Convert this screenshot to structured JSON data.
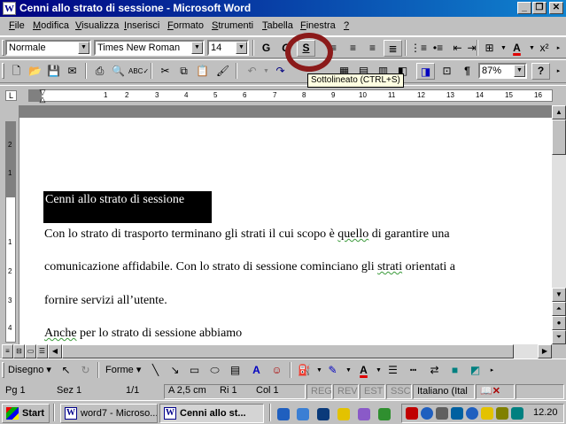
{
  "window": {
    "title": "Cenni allo strato di sessione - Microsoft Word",
    "buttons": {
      "minimize": "_",
      "restore": "❐",
      "close": "✕"
    }
  },
  "menu": [
    "File",
    "Modifica",
    "Visualizza",
    "Inserisci",
    "Formato",
    "Strumenti",
    "Tabella",
    "Finestra",
    "?"
  ],
  "formatting_toolbar": {
    "style": "Normale",
    "font": "Times New Roman",
    "size": "14",
    "bold": "G",
    "italic": "C",
    "underline": "S",
    "color_letter": "A"
  },
  "standard_toolbar": {
    "zoom": "87%",
    "pilcrow": "¶",
    "help": "?"
  },
  "tooltip": "Sottolineato (CTRL+S)",
  "ruler": {
    "numbers": [
      "1",
      "2",
      "3",
      "4",
      "5",
      "6",
      "7",
      "8",
      "9",
      "10",
      "11",
      "12",
      "13",
      "14",
      "15",
      "16"
    ],
    "vertical_numbers": [
      "2",
      "1",
      "1",
      "2",
      "3",
      "4",
      "5"
    ]
  },
  "document": {
    "heading": "Cenni allo strato di sessione",
    "line1_a": "Con lo strato di trasporto terminano gli strati il cui scopo è ",
    "line1_b": "quello",
    "line1_c": " di garantire una",
    "line2_a": "comunicazione affidabile. Con lo strato di sessione cominciano gli ",
    "line2_b": "strati",
    "line2_c": " orientati a",
    "line3": "fornire servizi all’utente.",
    "line4_a": "Anche",
    "line4_b": " per lo strato di sessione abbiamo"
  },
  "drawing_toolbar": {
    "draw": "Disegno",
    "shapes": "Forme"
  },
  "status": {
    "page": "Pg 1",
    "section": "Sez 1",
    "pages": "1/1",
    "at": "A 2,5 cm",
    "line": "Ri 1",
    "col": "Col 1",
    "rec": "REG",
    "rev": "REV",
    "ext": "EST",
    "ovr": "SSC",
    "language": "Italiano (Ital"
  },
  "taskbar": {
    "start": "Start",
    "tasks": [
      "word7 - Microso...",
      "Cenni allo st..."
    ],
    "clock": "12.20"
  }
}
